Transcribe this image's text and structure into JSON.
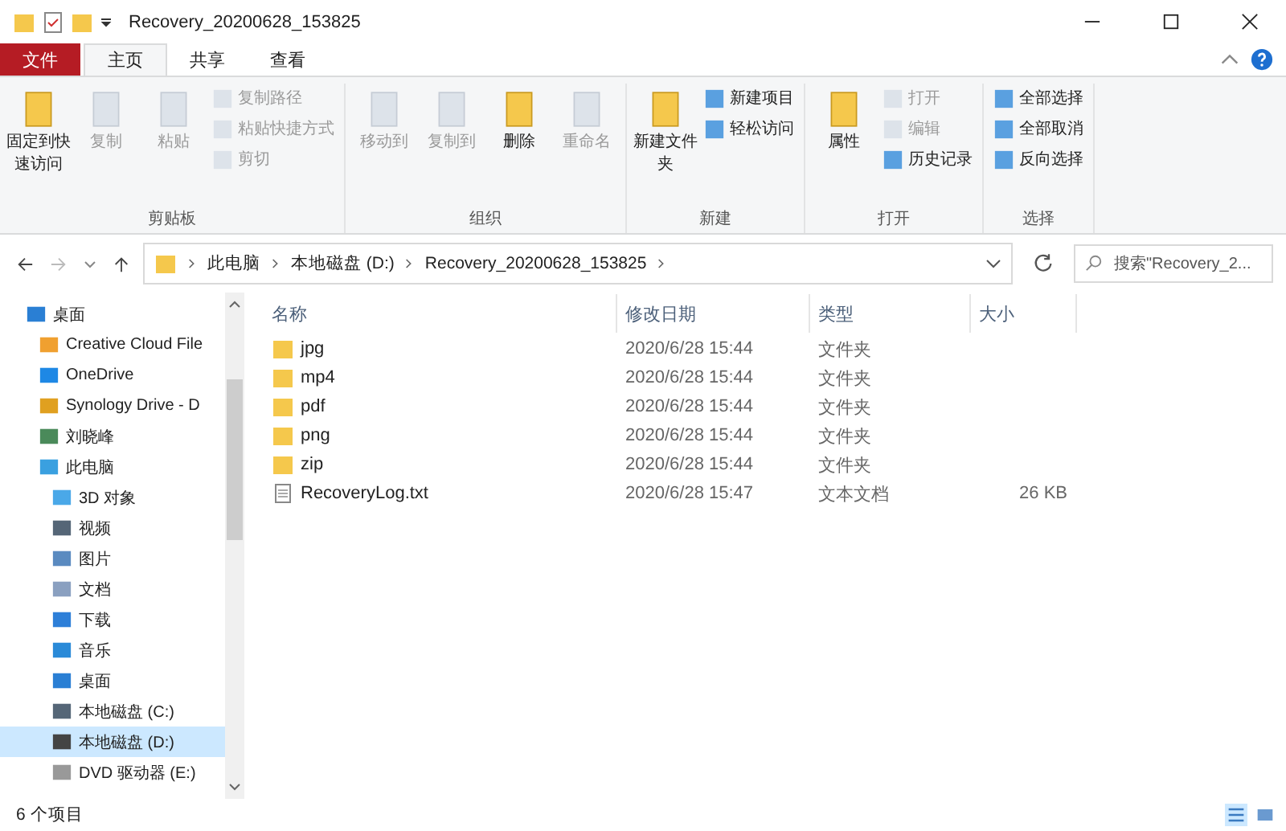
{
  "window": {
    "title": "Recovery_20200628_153825"
  },
  "ribbon_tabs": [
    {
      "label": "文件",
      "kind": "file",
      "selected": false
    },
    {
      "label": "主页",
      "kind": "tab",
      "selected": true
    },
    {
      "label": "共享",
      "kind": "tab",
      "selected": false
    },
    {
      "label": "查看",
      "kind": "tab",
      "selected": false
    }
  ],
  "ribbon_groups": [
    {
      "label": "剪贴板",
      "commands": [
        {
          "label": "固定到快速访问",
          "kind": "large",
          "disabled": false
        },
        {
          "label": "复制",
          "kind": "large",
          "disabled": true
        },
        {
          "label": "粘贴",
          "kind": "large",
          "disabled": true
        },
        {
          "label": "复制路径",
          "kind": "small",
          "disabled": true
        },
        {
          "label": "粘贴快捷方式",
          "kind": "small",
          "disabled": true
        },
        {
          "label": "剪切",
          "kind": "small",
          "disabled": true
        }
      ]
    },
    {
      "label": "组织",
      "commands": [
        {
          "label": "移动到",
          "kind": "large",
          "disabled": true
        },
        {
          "label": "复制到",
          "kind": "large",
          "disabled": true
        },
        {
          "label": "删除",
          "kind": "large",
          "disabled": false
        },
        {
          "label": "重命名",
          "kind": "large",
          "disabled": true
        }
      ]
    },
    {
      "label": "新建",
      "commands": [
        {
          "label": "新建文件夹",
          "kind": "large",
          "disabled": false
        },
        {
          "label": "新建项目",
          "kind": "small",
          "disabled": false
        },
        {
          "label": "轻松访问",
          "kind": "small",
          "disabled": false
        }
      ]
    },
    {
      "label": "打开",
      "commands": [
        {
          "label": "属性",
          "kind": "large",
          "disabled": false
        },
        {
          "label": "打开",
          "kind": "small",
          "disabled": true
        },
        {
          "label": "编辑",
          "kind": "small",
          "disabled": true
        },
        {
          "label": "历史记录",
          "kind": "small",
          "disabled": false
        }
      ]
    },
    {
      "label": "选择",
      "commands": [
        {
          "label": "全部选择",
          "kind": "small",
          "disabled": false
        },
        {
          "label": "全部取消",
          "kind": "small",
          "disabled": false
        },
        {
          "label": "反向选择",
          "kind": "small",
          "disabled": false
        }
      ]
    }
  ],
  "address": {
    "path": [
      "此电脑",
      "本地磁盘 (D:)",
      "Recovery_20200628_153825"
    ]
  },
  "search": {
    "placeholder": "搜索\"Recovery_2..."
  },
  "sidebar": {
    "items": [
      {
        "label": "桌面",
        "selected": false,
        "children": [
          {
            "label": "Creative Cloud File",
            "selected": false
          },
          {
            "label": "OneDrive",
            "selected": false
          },
          {
            "label": "Synology Drive - D",
            "selected": false
          },
          {
            "label": "刘晓峰",
            "selected": false
          },
          {
            "label": "此电脑",
            "selected": false,
            "children": [
              {
                "label": "3D 对象",
                "selected": false
              },
              {
                "label": "视频",
                "selected": false
              },
              {
                "label": "图片",
                "selected": false
              },
              {
                "label": "文档",
                "selected": false
              },
              {
                "label": "下载",
                "selected": false
              },
              {
                "label": "音乐",
                "selected": false
              },
              {
                "label": "桌面",
                "selected": false
              },
              {
                "label": "本地磁盘 (C:)",
                "selected": false
              },
              {
                "label": "本地磁盘 (D:)",
                "selected": true
              },
              {
                "label": "DVD 驱动器 (E:)",
                "selected": false
              }
            ]
          }
        ]
      }
    ]
  },
  "table": {
    "columns": [
      "名称",
      "修改日期",
      "类型",
      "大小"
    ],
    "rows": [
      {
        "kind": "folder",
        "name": "jpg",
        "modified": "2020/6/28 15:44",
        "type": "文件夹",
        "size": ""
      },
      {
        "kind": "folder",
        "name": "mp4",
        "modified": "2020/6/28 15:44",
        "type": "文件夹",
        "size": ""
      },
      {
        "kind": "folder",
        "name": "pdf",
        "modified": "2020/6/28 15:44",
        "type": "文件夹",
        "size": ""
      },
      {
        "kind": "folder",
        "name": "png",
        "modified": "2020/6/28 15:44",
        "type": "文件夹",
        "size": ""
      },
      {
        "kind": "folder",
        "name": "zip",
        "modified": "2020/6/28 15:44",
        "type": "文件夹",
        "size": ""
      },
      {
        "kind": "file",
        "name": "RecoveryLog.txt",
        "modified": "2020/6/28 15:47",
        "type": "文本文档",
        "size": "26 KB"
      }
    ]
  },
  "status_bar": {
    "count": "6 个项目"
  }
}
